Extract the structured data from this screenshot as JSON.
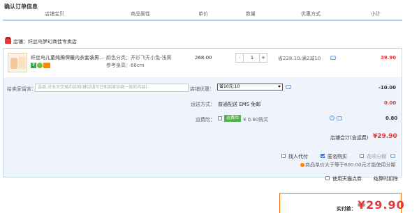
{
  "page_title": "确认订单信息",
  "columns": [
    "店铺宝贝",
    "商品属性",
    "单价",
    "数量",
    "优惠方式",
    "小计"
  ],
  "shop": {
    "label": "店铺：",
    "name": "纤丝鸟梦幻商佳专卖店"
  },
  "item": {
    "name": "纤丝鸟儿童纯棉保暖内衣套装男…",
    "attr_color": "颜色分类：开衫飞天小兔-浅黄",
    "attr_height": "参考身高：66cm",
    "badge_7": "7",
    "unit_price": "268.00",
    "qty_minus": "-",
    "quantity": "1",
    "qty_plus": "+",
    "promo": "省228.10:满2减10",
    "subtotal": "39.90"
  },
  "message": {
    "label": "给卖家留言：",
    "placeholder": "选填:对本次交易的说明(建议填写已和卖家协商一致的内容)"
  },
  "shop_promo": {
    "label": "店铺优惠：",
    "selected": "省10元:10",
    "value": "-10.00"
  },
  "shipping": {
    "label": "运送方式：",
    "method": "普通配送 EMS 免邮",
    "value": "0.00"
  },
  "insurance": {
    "label": "运费险：",
    "badge": "运费险",
    "text": "¥ 0.80购买",
    "help": "?",
    "value": "0.80"
  },
  "shop_total": {
    "label": "店铺合计(含运费)",
    "value": "¥29.90"
  },
  "options": {
    "agent_pay": "找人代付",
    "anonymous": "匿名购买",
    "huabei": "花呗分期",
    "warning": "商品单价大于等于600.00元才能使用分期",
    "tmall_coupon": "使用天猫点券",
    "settle_deduct": "结算时扣除"
  },
  "final": {
    "label": "实付款：",
    "value": "¥29.90"
  },
  "colors": {
    "price_red": "#e4393c",
    "accent_blue": "#b2d1ff",
    "highlight_orange": "#ff6a00"
  }
}
